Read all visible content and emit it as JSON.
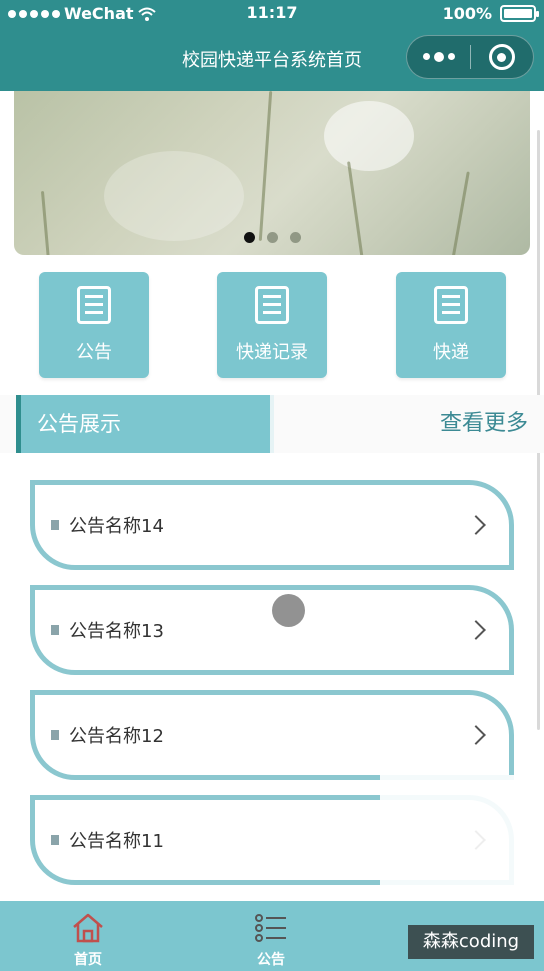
{
  "status_bar": {
    "carrier": "WeChat",
    "time": "11:17",
    "battery": "100%"
  },
  "nav": {
    "title": "校园快递平台系统首页"
  },
  "banner": {
    "slide_count": 3,
    "active_index": 0
  },
  "quick_menu": [
    {
      "label": "公告",
      "icon": "notice-icon"
    },
    {
      "label": "快递记录",
      "icon": "record-icon"
    },
    {
      "label": "快递",
      "icon": "express-icon"
    }
  ],
  "section": {
    "title": "公告展示",
    "more": "查看更多"
  },
  "notices": [
    {
      "title": "公告名称14"
    },
    {
      "title": "公告名称13"
    },
    {
      "title": "公告名称12"
    },
    {
      "title": "公告名称11"
    }
  ],
  "tabbar": {
    "items": [
      {
        "label": "首页",
        "icon": "home-icon"
      },
      {
        "label": "公告",
        "icon": "list-icon"
      }
    ]
  },
  "watermark": "森森coding",
  "colors": {
    "primary": "#2f8e8e",
    "accent": "#7cc6cf",
    "card_border": "#8bc7cf"
  }
}
